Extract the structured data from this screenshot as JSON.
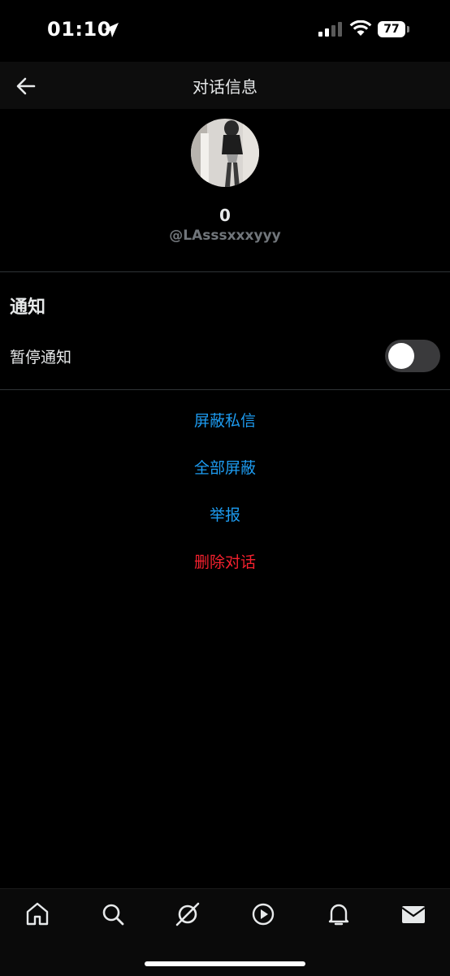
{
  "status_bar": {
    "time": "01:10",
    "battery": "77"
  },
  "header": {
    "title": "对话信息"
  },
  "profile": {
    "display_name": "0",
    "handle": "@LAsssxxxyyy"
  },
  "notifications": {
    "section_title": "通知",
    "snooze_label": "暂停通知",
    "snooze_enabled": false
  },
  "actions": {
    "block_dm": "屏蔽私信",
    "block_all": "全部屏蔽",
    "report": "举报",
    "delete_conversation": "删除对话"
  },
  "colors": {
    "accent": "#1d9bf0",
    "danger": "#f4212e",
    "background": "#000000"
  },
  "tabs": [
    "home-icon",
    "search-icon",
    "grok-icon",
    "video-icon",
    "bell-icon",
    "mail-icon"
  ]
}
